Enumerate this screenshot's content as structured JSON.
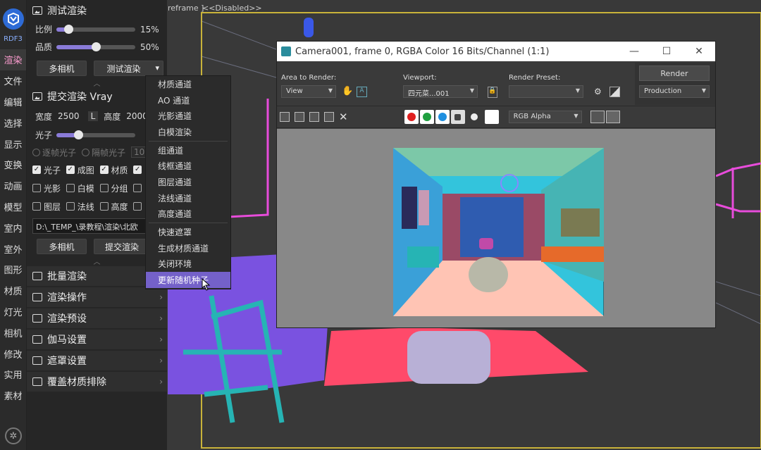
{
  "viewport": {
    "label_left": "reframe ]",
    "label_disabled": "<<Disabled>>"
  },
  "rail": {
    "brand": "RDF3",
    "items": [
      "渲染",
      "文件",
      "编辑",
      "选择",
      "显示",
      "变换",
      "动画",
      "模型",
      "室内",
      "室外",
      "图形",
      "材质",
      "灯光",
      "相机",
      "修改",
      "实用",
      "素材"
    ],
    "active_index": 0
  },
  "test_render": {
    "title": "测试渲染",
    "ratio_label": "比例",
    "ratio_value": "15%",
    "ratio_fraction": 0.15,
    "quality_label": "品质",
    "quality_value": "50%",
    "quality_fraction": 0.5,
    "multicam_button": "多相机",
    "test_render_dropdown": "测试渲染"
  },
  "submit_render": {
    "title": "提交渲染 Vray",
    "width_label": "宽度",
    "width_value": "2500",
    "lock_label": "L",
    "height_label": "高度",
    "height_value": "2000",
    "photon_label": "光子",
    "photon_fraction": 0.28,
    "radio_1": "逐帧光子",
    "radio_2": "隔帧光子",
    "radio_2_value": "10",
    "checks_row1": [
      {
        "label": "光子",
        "checked": true
      },
      {
        "label": "成图",
        "checked": true
      },
      {
        "label": "材质",
        "checked": true
      },
      {
        "label": "",
        "checked": true
      }
    ],
    "checks_row2": [
      {
        "label": "光影",
        "checked": false
      },
      {
        "label": "白模",
        "checked": false
      },
      {
        "label": "分组",
        "checked": false
      },
      {
        "label": "",
        "checked": false
      }
    ],
    "checks_row3": [
      {
        "label": "图层",
        "checked": false
      },
      {
        "label": "法线",
        "checked": false
      },
      {
        "label": "高度",
        "checked": false
      },
      {
        "label": "",
        "checked": false
      }
    ],
    "path": "D:\\_TEMP_\\录教程\\渲染\\北欧",
    "multicam_button": "多相机",
    "submit_button": "提交渲染"
  },
  "accordions": [
    "批量渲染",
    "渲染操作",
    "渲染预设",
    "伽马设置",
    "遮罩设置",
    "覆盖材质排除"
  ],
  "context_menu": {
    "group1": [
      "材质通道",
      "AO 通道",
      "光影通道",
      "白模渲染"
    ],
    "group2": [
      "组通道",
      "线框通道",
      "图层通道",
      "法线通道",
      "高度通道"
    ],
    "group3": [
      "快速遮罩",
      "生成材质通道",
      "关闭环境",
      "更新随机种子"
    ],
    "highlighted": "更新随机种子"
  },
  "vfb": {
    "title": "Camera001, frame 0, RGBA Color 16 Bits/Channel (1:1)",
    "area_label": "Area to Render:",
    "area_value": "View",
    "viewport_label": "Viewport:",
    "viewport_value": "四元菜...001",
    "preset_label": "Render Preset:",
    "preset_value": "",
    "render_button": "Render",
    "production_value": "Production",
    "channel_value": "RGB Alpha",
    "channel_colors": [
      "#e02020",
      "#20a040",
      "#2090e0"
    ]
  }
}
